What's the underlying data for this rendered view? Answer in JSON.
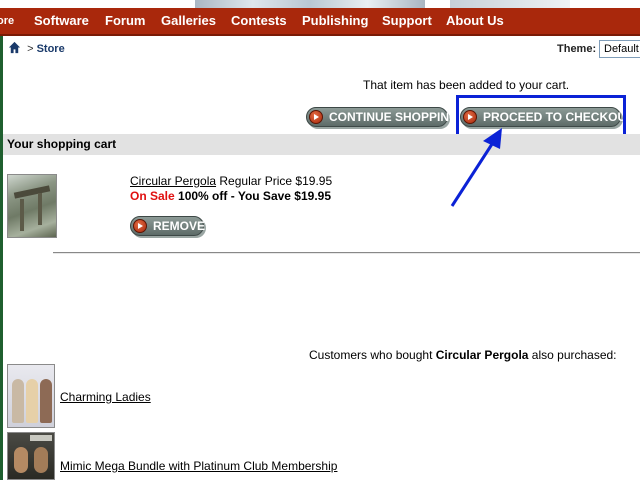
{
  "nav": {
    "items": [
      {
        "label": "ore"
      },
      {
        "label": "Software"
      },
      {
        "label": "Forum"
      },
      {
        "label": "Galleries"
      },
      {
        "label": "Contests"
      },
      {
        "label": "Publishing"
      },
      {
        "label": "Support"
      },
      {
        "label": "About Us"
      }
    ]
  },
  "breadcrumb": {
    "separator": ">",
    "current": "Store"
  },
  "theme": {
    "label": "Theme:",
    "selected": "Default"
  },
  "cart": {
    "added_message": "That item has been added to your cart.",
    "continue_label": "CONTINUE SHOPPING",
    "checkout_label": "PROCEED TO CHECKOUT",
    "section_title": "Your shopping cart",
    "item": {
      "name": "Circular Pergola",
      "regular_price_text": "Regular Price $19.95",
      "on_sale": "On Sale",
      "discount": "100% off - You Save $19.95",
      "remove_label": "REMOVE"
    }
  },
  "related": {
    "prefix": "Customers who bought",
    "product": "Circular Pergola",
    "suffix": "also purchased:",
    "items": [
      {
        "label": "Charming Ladies"
      },
      {
        "label": "Mimic Mega Bundle with Platinum Club Membership"
      }
    ]
  },
  "colors": {
    "nav_bg": "#a9280c",
    "highlight": "#0b22d6",
    "sale_red": "#e01010",
    "section_bg": "#e2e2e2"
  }
}
